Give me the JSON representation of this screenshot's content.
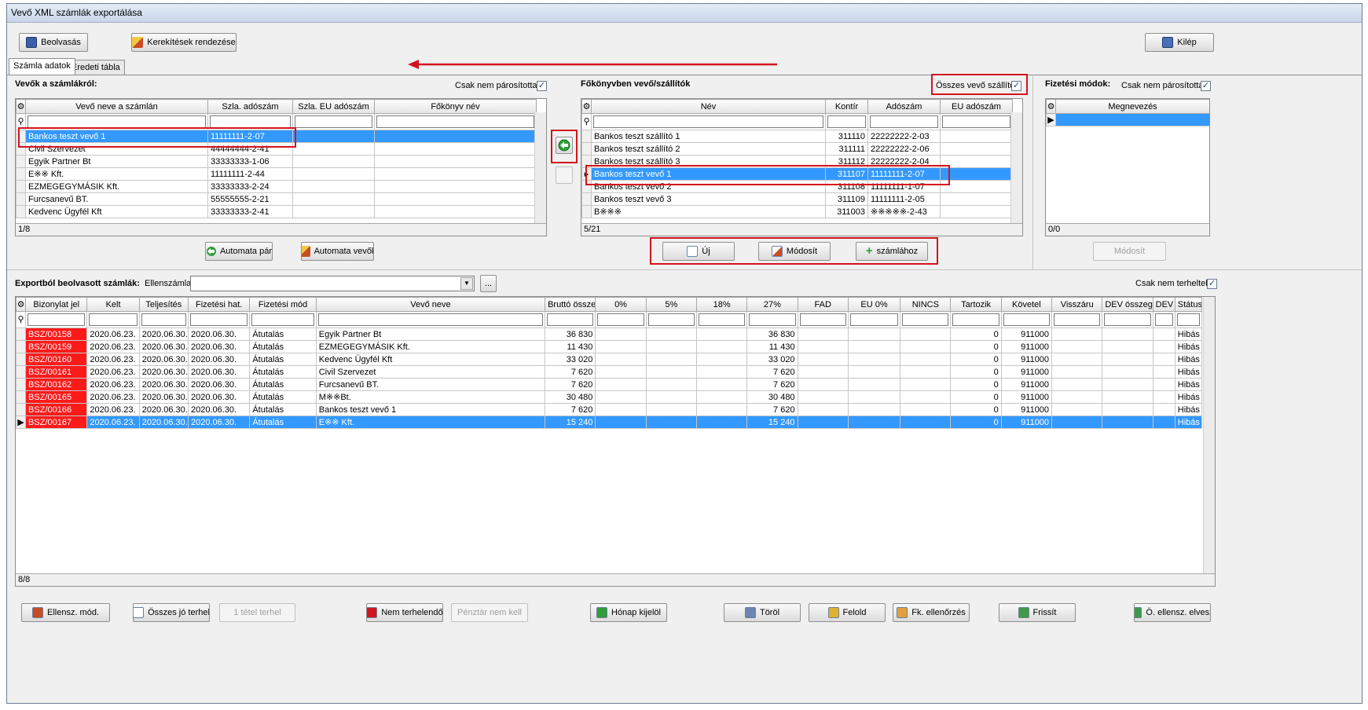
{
  "window": {
    "title": "Vevő XML számlák exportálása"
  },
  "toolbar": {
    "read_label": "Beolvasás",
    "round_label": "Kerekítések rendezése",
    "exit_label": "Kilép"
  },
  "tabs": [
    {
      "label": "Számla adatok"
    },
    {
      "label": "Eredeti tábla"
    }
  ],
  "customers": {
    "title": "Vevők a számlákról:",
    "only_unpaired_label": "Csak nem párosítottak",
    "only_unpaired_checked": true,
    "columns": [
      "Vevő neve a számlán",
      "Szla. adószám",
      "Szla. EU adószám",
      "Főkönyv név"
    ],
    "rows": [
      [
        "Bankos teszt vevő 1",
        "11111111-2-07",
        "",
        ""
      ],
      [
        "Civil Szervezet",
        "44444444-2-41",
        "",
        ""
      ],
      [
        "Egyik Partner Bt",
        "33333333-1-06",
        "",
        ""
      ],
      [
        "E※※ Kft.",
        "11111111-2-44",
        "",
        ""
      ],
      [
        "EZMEGEGYMÁSIK Kft.",
        "33333333-2-24",
        "",
        ""
      ],
      [
        "Furcsanevű BT.",
        "55555555-2-21",
        "",
        ""
      ],
      [
        "Kedvenc Ügyfél Kft",
        "33333333-2-41",
        "",
        ""
      ]
    ],
    "status": "1/8",
    "auto_pair_label": "Automata pár",
    "auto_customers_label": "Automata vevők"
  },
  "ledger": {
    "title": "Főkönyvben vevő/szállítók",
    "all_label": "Összes vevő szállító",
    "all_checked": true,
    "columns": [
      "Név",
      "Kontír",
      "Adószám",
      "EU adószám"
    ],
    "rows": [
      [
        "Bankos teszt szállító 1",
        "311110",
        "22222222-2-03",
        ""
      ],
      [
        "Bankos teszt szállító 2",
        "311111",
        "22222222-2-06",
        ""
      ],
      [
        "Bankos teszt szállító 3",
        "311112",
        "22222222-2-04",
        ""
      ],
      [
        "Bankos teszt vevő 1",
        "311107",
        "11111111-2-07",
        ""
      ],
      [
        "Bankos teszt vevő 2",
        "311108",
        "11111111-1-07",
        ""
      ],
      [
        "Bankos teszt vevő 3",
        "311109",
        "11111111-2-05",
        ""
      ],
      [
        "B※※※",
        "311003",
        "※※※※※-2-43",
        ""
      ]
    ],
    "status": "5/21",
    "new_label": "Új",
    "modify_label": "Módosít",
    "to_invoice_label": "számlához"
  },
  "payment": {
    "title": "Fizetési módok:",
    "only_unpaired_label": "Csak nem párosítottak",
    "only_unpaired_checked": true,
    "column": "Megnevezés",
    "status": "0/0",
    "modify_label": "Módosít"
  },
  "invoices": {
    "title": "Exportból beolvasott számlák:",
    "counter_account_label": "Ellenszámla:",
    "counter_account_value": "",
    "browse_label": "...",
    "only_unbooked_label": "Csak nem terheltek",
    "only_unbooked_checked": true,
    "columns": [
      "Bizonylat jel",
      "Kelt",
      "Teljesítés",
      "Fizetési hat.",
      "Fizetési mód",
      "Vevő neve",
      "Bruttó összeg",
      "0%",
      "5%",
      "18%",
      "27%",
      "FAD",
      "EU 0%",
      "NINCS",
      "Tartozik",
      "Követel",
      "Visszáru",
      "DEV összeg",
      "DEV",
      "Státusz"
    ],
    "rows": [
      [
        "BSZ/00158",
        "2020.06.23.",
        "2020.06.30.",
        "2020.06.30.",
        "Átutalás",
        "Egyik Partner Bt",
        "36 830",
        "",
        "",
        "",
        "36 830",
        "",
        "",
        "",
        "0",
        "911000",
        "",
        "",
        "",
        "Hibás"
      ],
      [
        "BSZ/00159",
        "2020.06.23.",
        "2020.06.30.",
        "2020.06.30.",
        "Átutalás",
        "EZMEGEGYMÁSIK Kft.",
        "11 430",
        "",
        "",
        "",
        "11 430",
        "",
        "",
        "",
        "0",
        "911000",
        "",
        "",
        "",
        "Hibás"
      ],
      [
        "BSZ/00160",
        "2020.06.23.",
        "2020.06.30.",
        "2020.06.30.",
        "Átutalás",
        "Kedvenc Ügyfél Kft",
        "33 020",
        "",
        "",
        "",
        "33 020",
        "",
        "",
        "",
        "0",
        "911000",
        "",
        "",
        "",
        "Hibás"
      ],
      [
        "BSZ/00161",
        "2020.06.23.",
        "2020.06.30.",
        "2020.06.30.",
        "Átutalás",
        "Civil Szervezet",
        "7 620",
        "",
        "",
        "",
        "7 620",
        "",
        "",
        "",
        "0",
        "911000",
        "",
        "",
        "",
        "Hibás"
      ],
      [
        "BSZ/00162",
        "2020.06.23.",
        "2020.06.30.",
        "2020.06.30.",
        "Átutalás",
        "Furcsanevű BT.",
        "7 620",
        "",
        "",
        "",
        "7 620",
        "",
        "",
        "",
        "0",
        "911000",
        "",
        "",
        "",
        "Hibás"
      ],
      [
        "BSZ/00165",
        "2020.06.23.",
        "2020.06.30.",
        "2020.06.30.",
        "Átutalás",
        "M※※Bt.",
        "30 480",
        "",
        "",
        "",
        "30 480",
        "",
        "",
        "",
        "0",
        "911000",
        "",
        "",
        "",
        "Hibás"
      ],
      [
        "BSZ/00166",
        "2020.06.23.",
        "2020.06.30.",
        "2020.06.30.",
        "Átutalás",
        "Bankos teszt vevő 1",
        "7 620",
        "",
        "",
        "",
        "7 620",
        "",
        "",
        "",
        "0",
        "911000",
        "",
        "",
        "",
        "Hibás"
      ],
      [
        "BSZ/00167",
        "2020.06.23.",
        "2020.06.30.",
        "2020.06.30.",
        "Átutalás",
        "E※※ Kft.",
        "15 240",
        "",
        "",
        "",
        "15 240",
        "",
        "",
        "",
        "0",
        "911000",
        "",
        "",
        "",
        "Hibás"
      ]
    ],
    "status": "8/8"
  },
  "footer": {
    "buttons": [
      {
        "label": "Ellensz. mód.",
        "icon": "edit-icon",
        "enabled": true
      },
      {
        "label": "Összes jó terhel",
        "icon": "document-icon",
        "enabled": true
      },
      {
        "label": "1 tétel terhel",
        "icon": "",
        "enabled": false
      },
      {
        "label": "Nem terhelendő",
        "icon": "cross-icon",
        "enabled": true
      },
      {
        "label": "Pénztár nem kell",
        "icon": "",
        "enabled": false
      },
      {
        "label": "Hónap kijelöl",
        "icon": "arrow-right-icon",
        "enabled": true
      },
      {
        "label": "Töröl",
        "icon": "delete-icon",
        "enabled": true
      },
      {
        "label": "Felold",
        "icon": "unlock-icon",
        "enabled": true
      },
      {
        "label": "Fk. ellenőrzés",
        "icon": "check-icon",
        "enabled": true
      },
      {
        "label": "Frissít",
        "icon": "refresh-icon",
        "enabled": true
      },
      {
        "label": "Ö. ellensz. elvesz",
        "icon": "refresh-icon",
        "enabled": true
      }
    ]
  },
  "colors": {
    "selection": "#3399ff",
    "error_cell": "#ff1a1a",
    "highlight_box": "#d2141e"
  }
}
